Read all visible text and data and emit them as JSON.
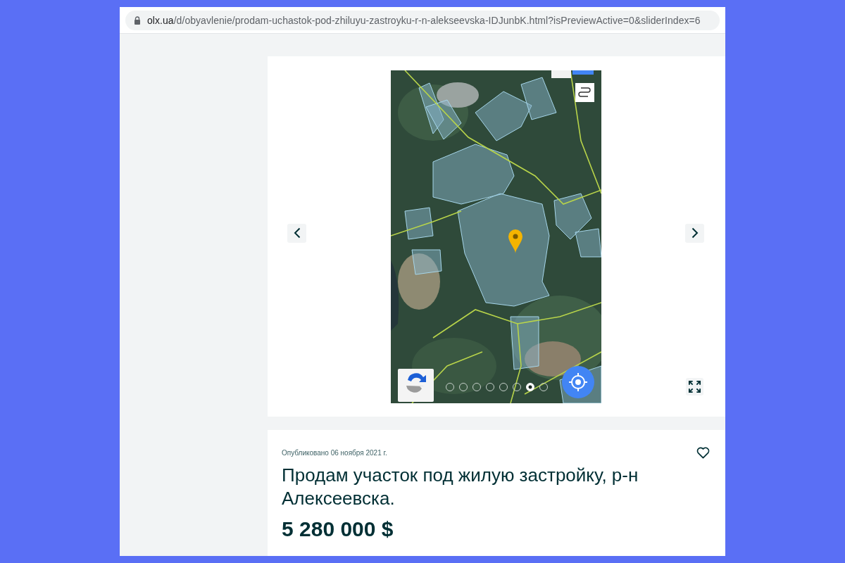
{
  "browser": {
    "url_host": "olx.ua",
    "url_path": "/d/obyavlenie/prodam-uchastok-pod-zhiluyu-zastroyku-r-n-alekseevska-IDJunbK.html?isPreviewActive=0&sliderIndex=6"
  },
  "gallery": {
    "slides": [
      {
        "selected": false
      },
      {
        "selected": false
      },
      {
        "selected": false
      },
      {
        "selected": false
      },
      {
        "selected": false
      },
      {
        "selected": false
      },
      {
        "selected": true
      },
      {
        "selected": false
      }
    ]
  },
  "listing": {
    "published": "Опубликовано 06 ноября 2021 г.",
    "title": "Продам участок под жилую застройку, р-н Алексеевска.",
    "price": "5 280 000 $"
  }
}
